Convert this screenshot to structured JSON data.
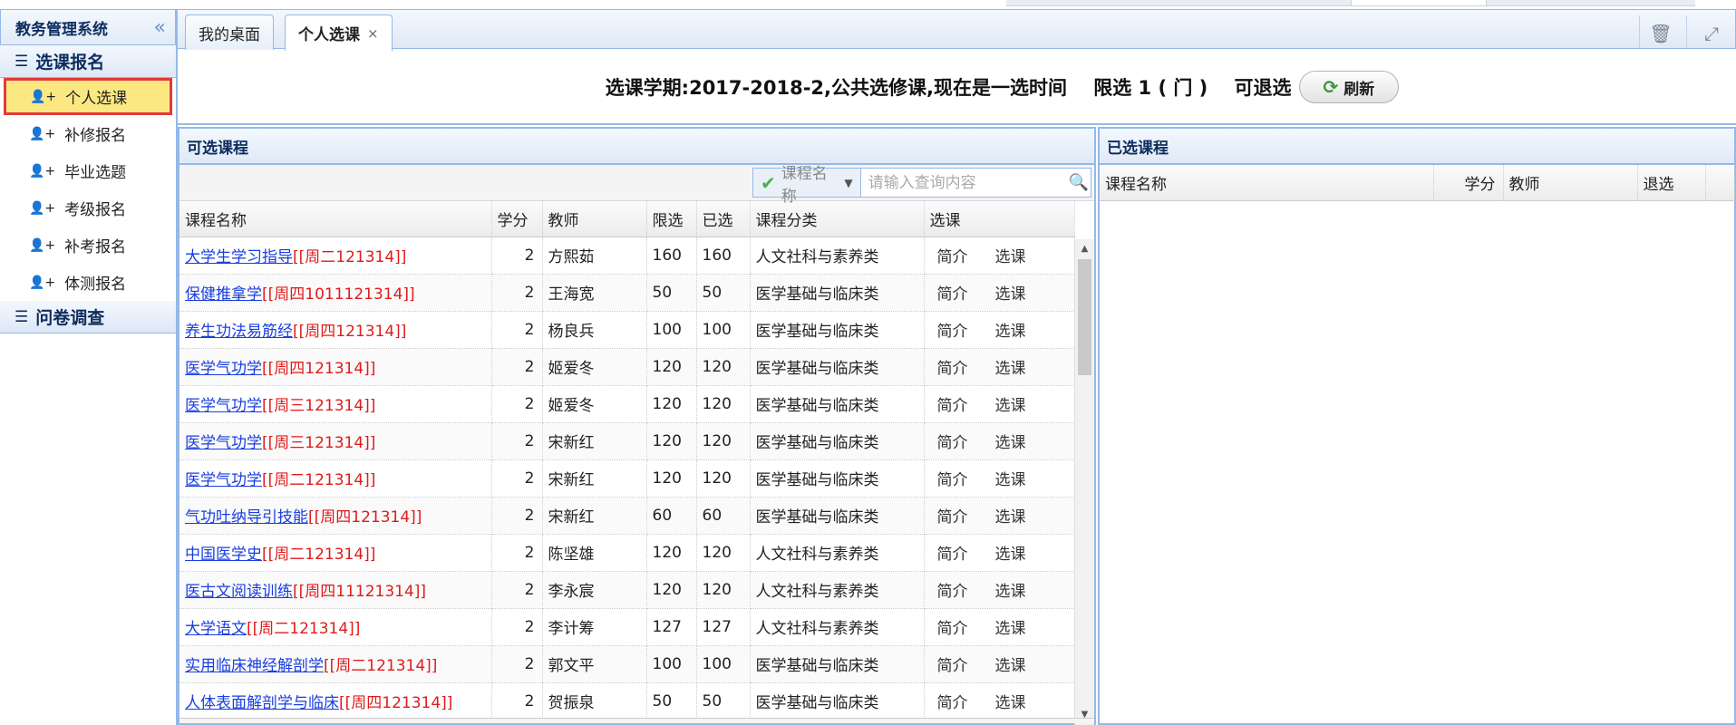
{
  "sidebar": {
    "title": "教务管理系统",
    "collapse_icon": "«",
    "groups": [
      {
        "label": "选课报名",
        "items": [
          "个人选课",
          "补修报名",
          "毕业选题",
          "考级报名",
          "补考报名",
          "体测报名"
        ]
      },
      {
        "label": "问卷调查",
        "items": []
      }
    ]
  },
  "tabs": [
    {
      "label": "我的桌面"
    },
    {
      "label": "个人选课",
      "close": "×"
    }
  ],
  "info": {
    "message": "选课学期:2017-2018-2,公共选修课,现在是一选时间    限选 1 ( 门 )    可退选",
    "refresh_label": "刷新"
  },
  "available": {
    "title": "可选课程",
    "search": {
      "category": "课程名称",
      "placeholder": "请输入查询内容"
    },
    "columns": [
      "课程名称",
      "学分",
      "教师",
      "限选",
      "已选",
      "课程分类",
      "选课"
    ],
    "actions": [
      "简介",
      "选课"
    ],
    "rows": [
      {
        "name": "大学生学习指导",
        "time": "[[周二121314]]",
        "credit": "2",
        "teacher": "方熙茹",
        "limit": "160",
        "selected": "160",
        "category": "人文社科与素养类"
      },
      {
        "name": "保健推拿学",
        "time": "[[周四1011121314]]",
        "credit": "2",
        "teacher": "王海宽",
        "limit": "50",
        "selected": "50",
        "category": "医学基础与临床类"
      },
      {
        "name": "养生功法易筋经",
        "time": "[[周四121314]]",
        "credit": "2",
        "teacher": "杨良兵",
        "limit": "100",
        "selected": "100",
        "category": "医学基础与临床类"
      },
      {
        "name": "医学气功学",
        "time": "[[周四121314]]",
        "credit": "2",
        "teacher": "姬爱冬",
        "limit": "120",
        "selected": "120",
        "category": "医学基础与临床类"
      },
      {
        "name": "医学气功学",
        "time": "[[周三121314]]",
        "credit": "2",
        "teacher": "姬爱冬",
        "limit": "120",
        "selected": "120",
        "category": "医学基础与临床类"
      },
      {
        "name": "医学气功学",
        "time": "[[周三121314]]",
        "credit": "2",
        "teacher": "宋新红",
        "limit": "120",
        "selected": "120",
        "category": "医学基础与临床类"
      },
      {
        "name": "医学气功学",
        "time": "[[周二121314]]",
        "credit": "2",
        "teacher": "宋新红",
        "limit": "120",
        "selected": "120",
        "category": "医学基础与临床类"
      },
      {
        "name": "气功吐纳导引技能",
        "time": "[[周四121314]]",
        "credit": "2",
        "teacher": "宋新红",
        "limit": "60",
        "selected": "60",
        "category": "医学基础与临床类"
      },
      {
        "name": "中国医学史",
        "time": "[[周二121314]]",
        "credit": "2",
        "teacher": "陈坚雄",
        "limit": "120",
        "selected": "120",
        "category": "人文社科与素养类"
      },
      {
        "name": "医古文阅读训练",
        "time": "[[周四11121314]]",
        "credit": "2",
        "teacher": "李永宸",
        "limit": "120",
        "selected": "120",
        "category": "人文社科与素养类"
      },
      {
        "name": "大学语文",
        "time": "[[周二121314]]",
        "credit": "2",
        "teacher": "李计筹",
        "limit": "127",
        "selected": "127",
        "category": "人文社科与素养类"
      },
      {
        "name": "实用临床神经解剖学",
        "time": "[[周二121314]]",
        "credit": "2",
        "teacher": "郭文平",
        "limit": "100",
        "selected": "100",
        "category": "医学基础与临床类"
      },
      {
        "name": "人体表面解剖学与临床",
        "time": "[[周四121314]]",
        "credit": "2",
        "teacher": "贺振泉",
        "limit": "50",
        "selected": "50",
        "category": "医学基础与临床类"
      }
    ]
  },
  "selected": {
    "title": "已选课程",
    "columns": [
      "课程名称",
      "学分",
      "教师",
      "退选"
    ]
  }
}
